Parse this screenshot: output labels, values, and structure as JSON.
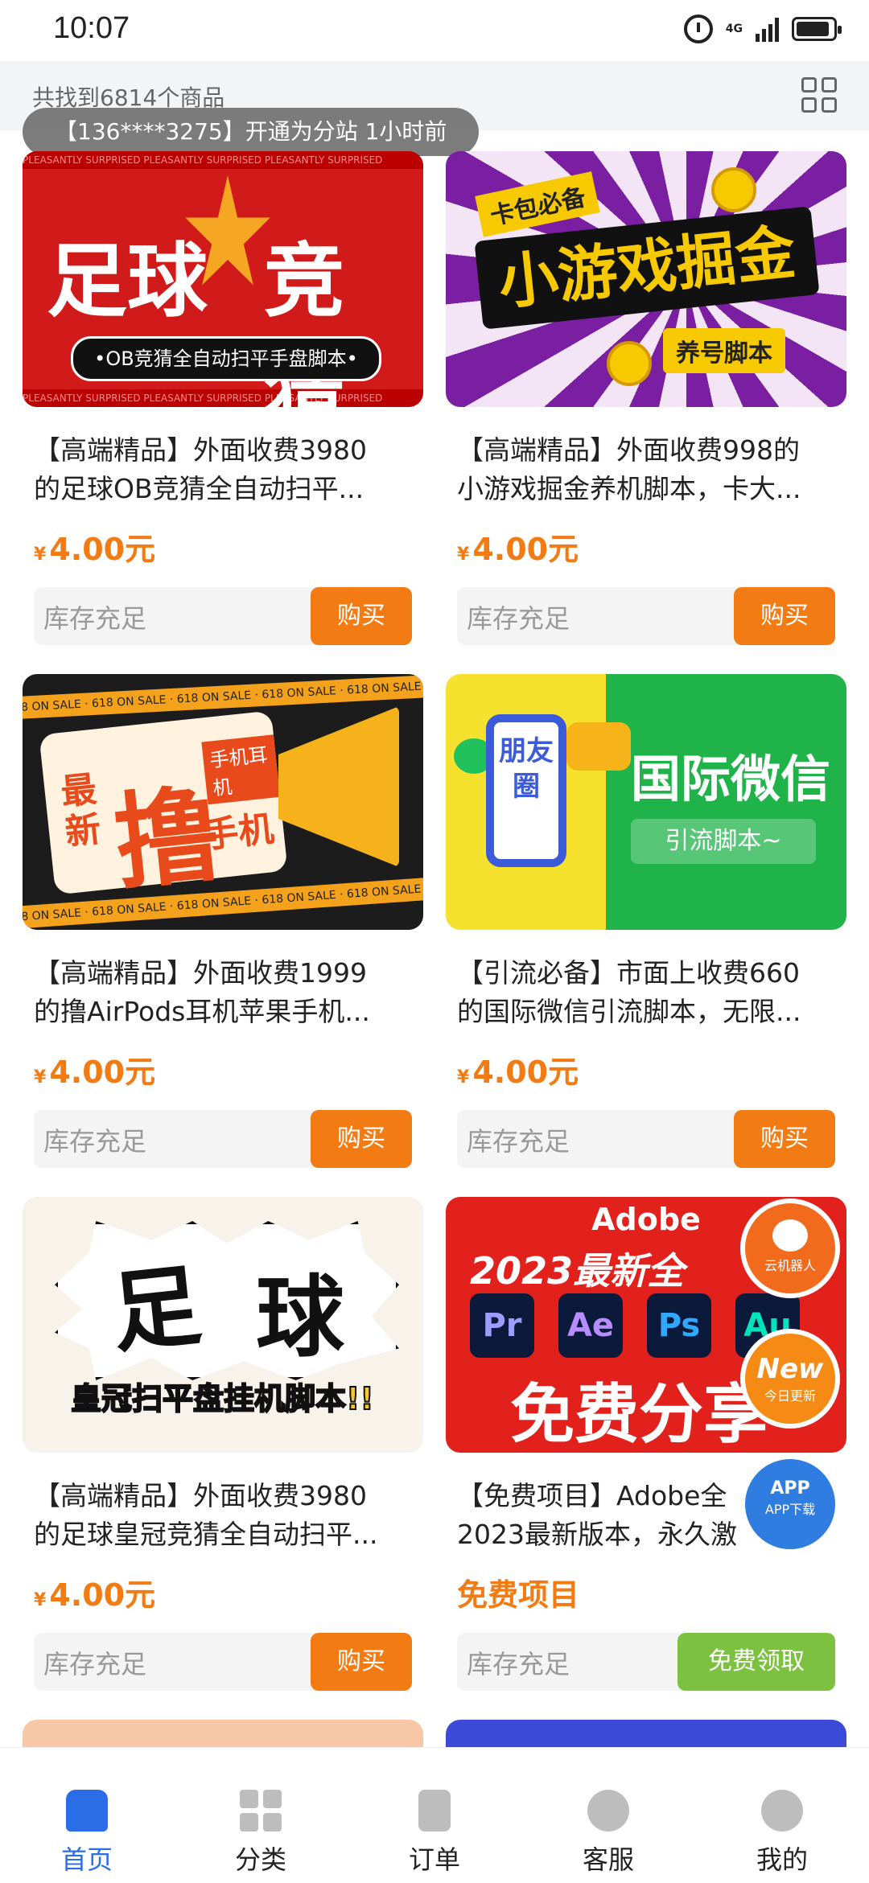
{
  "status_bar": {
    "time": "10:07",
    "network": "4G"
  },
  "header": {
    "result_count": "共找到6814个商品"
  },
  "notice": "【136****3275】开通为分站 1小时前",
  "stock_label": "库存充足",
  "buy_label": "购买",
  "free_claim_label": "免费领取",
  "products": [
    {
      "title_line1": "【高端精品】外面收费3980",
      "title_line2": "的足球OB竞猜全自动扫平...",
      "price": "4.00元",
      "currency": "¥",
      "thumb": {
        "word_left": "足球",
        "word_right": "竞猜",
        "pill": "•OB竞猜全自动扫平手盘脚本•",
        "band": "PLEASANTLY SURPRISED  PLEASANTLY SURPRISED  PLEASANTLY SURPRISED"
      }
    },
    {
      "title_line1": "【高端精品】外面收费998的",
      "title_line2": "小游戏掘金养机脚本，卡大...",
      "price": "4.00元",
      "currency": "¥",
      "thumb": {
        "tag": "卡包必备",
        "main": "小游戏掘金",
        "sub": "养号脚本"
      }
    },
    {
      "title_line1": "【高端精品】外面收费1999",
      "title_line2": "的撸AirPods耳机苹果手机...",
      "price": "4.00元",
      "currency": "¥",
      "thumb": {
        "tape": "618 ON SALE · 618 ON SALE · 618 ON SALE · 618 ON SALE · 618 ON SALE",
        "big": "撸",
        "side": "最新",
        "right": "手机",
        "badge": "手机耳机"
      }
    },
    {
      "title_line1": "【引流必备】市面上收费660",
      "title_line2": "的国际微信引流脚本，无限...",
      "price": "4.00元",
      "currency": "¥",
      "thumb": {
        "phone": "朋友圈",
        "title": "国际微信",
        "sub": "引流脚本~"
      }
    },
    {
      "title_line1": "【高端精品】外面收费3980",
      "title_line2": "的足球皇冠竞猜全自动扫平...",
      "price": "4.00元",
      "currency": "¥",
      "thumb": {
        "w1": "足",
        "w2": "球",
        "sub": "皇冠扫平盘挂机脚本!!"
      }
    },
    {
      "title_line1": "【免费项目】Adobe全",
      "title_line2": "2023最新版本，永久激",
      "price": "免费项目",
      "thumb": {
        "h1": "Adobe",
        "h2": "2023最新全",
        "tiles": [
          "Pr",
          "Ae",
          "Ps",
          "Au"
        ],
        "h3": "免费分享"
      }
    }
  ],
  "floating": {
    "robot": "云机器人",
    "new_badge": "New",
    "new": "今日更新",
    "app_badge": "APP",
    "app": "APP下载"
  },
  "nav": [
    {
      "label": "首页",
      "icon": "home-icon",
      "active": true
    },
    {
      "label": "分类",
      "icon": "category-icon",
      "active": false
    },
    {
      "label": "订单",
      "icon": "order-icon",
      "active": false
    },
    {
      "label": "客服",
      "icon": "headset-icon",
      "active": false
    },
    {
      "label": "我的",
      "icon": "profile-icon",
      "active": false
    }
  ],
  "colors": {
    "accent": "#f27b14",
    "free": "#7cc240",
    "nav_active": "#2b6de6"
  }
}
